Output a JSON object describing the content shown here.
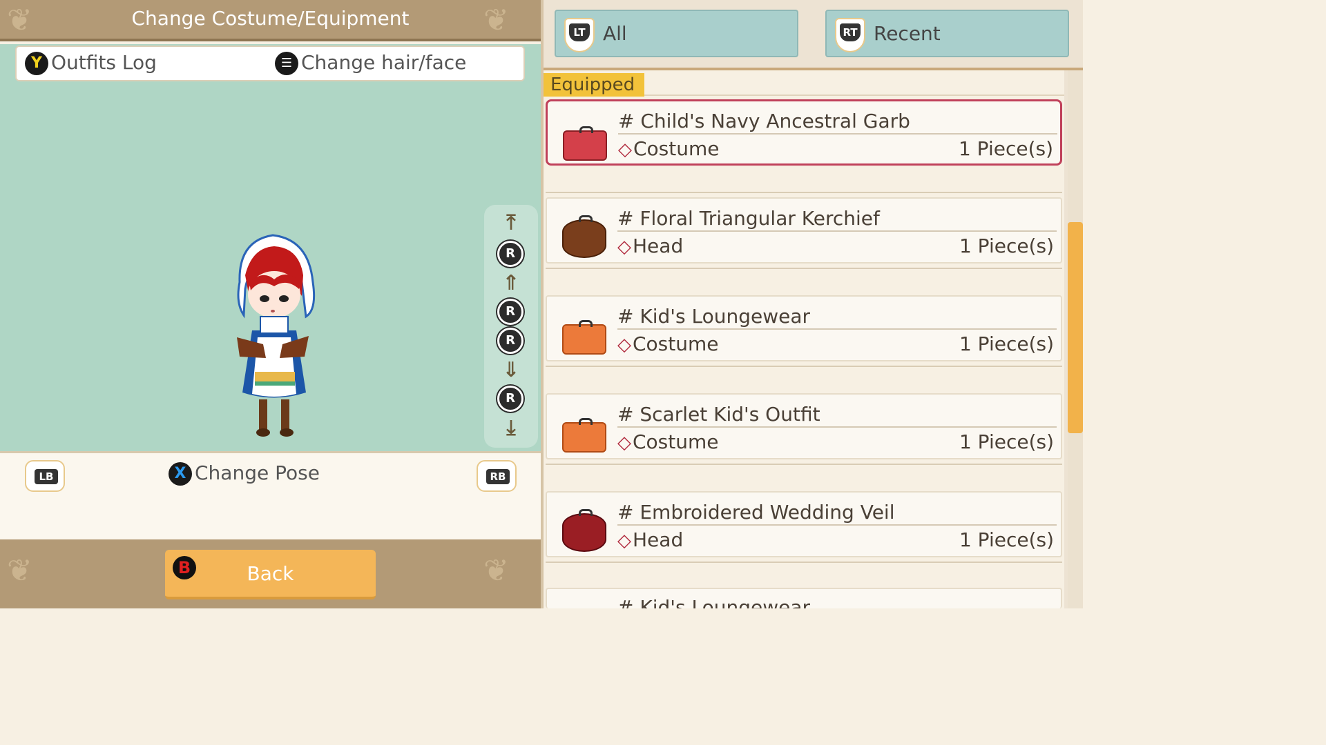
{
  "header": {
    "title": "Change Costume/Equipment"
  },
  "camera": {
    "r_label": "R"
  },
  "controls": {
    "lb": "LB",
    "rb": "RB",
    "change_pose_glyph": "X",
    "change_pose": "Change Pose",
    "outfits_log_glyph": "Y",
    "outfits_log": "Outfits Log",
    "change_hair_face": "Change hair/face"
  },
  "back": {
    "glyph": "B",
    "label": "Back"
  },
  "tabs": [
    {
      "trigger": "LT",
      "label": "All"
    },
    {
      "trigger": "RT",
      "label": "Recent"
    }
  ],
  "list": {
    "section_label": "Equipped",
    "items": [
      {
        "name": "# Child's Navy Ancestral Garb",
        "category": "Costume",
        "qty": "1 Piece(s)",
        "icon": "red-suitcase-icon"
      },
      {
        "name": "# Floral Triangular Kerchief",
        "category": "Head",
        "qty": "1 Piece(s)",
        "icon": "brown-hatbox-icon"
      },
      {
        "name": "# Kid's Loungewear",
        "category": "Costume",
        "qty": "1 Piece(s)",
        "icon": "orange-suitcase-icon"
      },
      {
        "name": "# Scarlet Kid's Outfit",
        "category": "Costume",
        "qty": "1 Piece(s)",
        "icon": "orange-suitcase-icon"
      },
      {
        "name": "# Embroidered Wedding Veil",
        "category": "Head",
        "qty": "1 Piece(s)",
        "icon": "red-hatbox-icon"
      },
      {
        "name": "# Kid's Loungewear",
        "category": "",
        "qty": "",
        "icon": "orange-suitcase-icon"
      }
    ]
  },
  "colors": {
    "accent_orange": "#f4b658",
    "selection_border": "#c0405a",
    "tab_bg": "#a9cfcc",
    "preview_bg": "#afd6c5",
    "equipped_badge": "#f2c23a"
  }
}
